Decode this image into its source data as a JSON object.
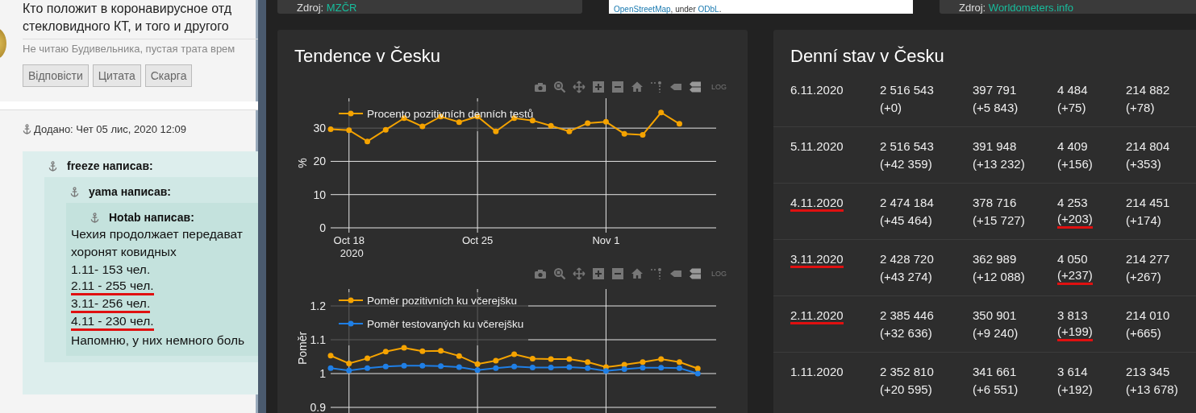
{
  "forum": {
    "post_text": [
      "Кто положит в коронавирусное отд",
      "стекловидного КТ, и того и другого"
    ],
    "signature": "Не читаю Будивельника, пустая трата врем",
    "buttons": [
      "Відповісти",
      "Цитата",
      "Скарга"
    ],
    "posted": "Додано: Чет 05 лис, 2020 12:09",
    "quote": {
      "author": "freeze написав:",
      "quote": {
        "author": "yama написав:",
        "quote": {
          "author": "Hotab написав:",
          "lines": [
            {
              "text": "Чехия продолжает передават",
              "marked": false
            },
            {
              "text": "хоронят ковидных",
              "marked": false
            },
            {
              "text": "1.11- 153 чел.",
              "marked": false
            },
            {
              "text": "2.11 - 255 чел.",
              "marked": true
            },
            {
              "text": "3.11- 256 чел.",
              "marked": true
            },
            {
              "text": "4.11 - 230 чел.",
              "marked": true
            },
            {
              "text": "Напомню, у них немного боль",
              "marked": false
            }
          ]
        }
      }
    }
  },
  "top_cards": [
    {
      "kind": "source",
      "label": "Zdroj:",
      "link": "MZČR"
    },
    {
      "kind": "attribution",
      "parts": [
        {
          "text": "OpenStreetMap",
          "link": true
        },
        {
          "text": ", under ",
          "link": false
        },
        {
          "text": "ODbL",
          "link": true
        },
        {
          "text": ".",
          "link": false
        }
      ]
    },
    {
      "kind": "source",
      "label": "Zdroj:",
      "link": "Worldometers.info"
    }
  ],
  "trend_panel": {
    "title": "Tendence v Česku",
    "charts": [
      {
        "toolbar_label": "LOG",
        "chart_data": {
          "type": "line",
          "ylabel": "%",
          "grid": true,
          "legend": true,
          "x": [
            "2020-10-17",
            "2020-10-18",
            "2020-10-19",
            "2020-10-20",
            "2020-10-21",
            "2020-10-22",
            "2020-10-23",
            "2020-10-24",
            "2020-10-25",
            "2020-10-26",
            "2020-10-27",
            "2020-10-28",
            "2020-10-29",
            "2020-10-30",
            "2020-10-31",
            "2020-11-01",
            "2020-11-02",
            "2020-11-03",
            "2020-11-04",
            "2020-11-05"
          ],
          "series": [
            {
              "name": "Procento pozitivních denních testů",
              "color": "#f5a300",
              "marker": true,
              "values": [
                29.7,
                29.4,
                26,
                29.5,
                33,
                30.5,
                33.5,
                31.8,
                33.5,
                29,
                33,
                32.3,
                30.7,
                29,
                31.5,
                31.9,
                28.3,
                28,
                34.7,
                31.3
              ]
            }
          ],
          "xlim": [
            "2020-10-17",
            "2020-11-07"
          ],
          "ylim": [
            0,
            39
          ],
          "yticks": [
            0,
            10,
            20,
            30
          ],
          "xticks": [
            {
              "value": "2020-10-18",
              "label": "Oct 18\n2020"
            },
            {
              "value": "2020-10-25",
              "label": "Oct 25"
            },
            {
              "value": "2020-11-01",
              "label": "Nov 1"
            }
          ]
        }
      },
      {
        "toolbar_label": "LOG",
        "chart_data": {
          "type": "line",
          "ylabel": "Poměr",
          "grid": true,
          "legend": true,
          "xlim": [
            "2020-10-17",
            "2020-11-07"
          ],
          "ylim": [
            0.9,
            1.25
          ],
          "x": [
            "2020-10-17",
            "2020-10-18",
            "2020-10-19",
            "2020-10-20",
            "2020-10-21",
            "2020-10-22",
            "2020-10-23",
            "2020-10-24",
            "2020-10-25",
            "2020-10-26",
            "2020-10-27",
            "2020-10-28",
            "2020-10-29",
            "2020-10-30",
            "2020-10-31",
            "2020-11-01",
            "2020-11-02",
            "2020-11-03",
            "2020-11-04",
            "2020-11-05",
            "2020-11-06"
          ],
          "series": [
            {
              "name": "Poměr pozitivních ku včerejšku",
              "color": "#f5a300",
              "marker": true,
              "values": [
                1.053,
                1.03,
                1.045,
                1.065,
                1.076,
                1.066,
                1.067,
                1.052,
                1.028,
                1.038,
                1.057,
                1.044,
                1.043,
                1.043,
                1.034,
                1.019,
                1.026,
                1.034,
                1.043,
                1.034,
                1.015
              ]
            },
            {
              "name": "Poměr testovaných ku včerejšku",
              "color": "#1f7fe6",
              "marker": true,
              "values": [
                1.016,
                1.009,
                1.016,
                1.021,
                1.023,
                1.023,
                1.022,
                1.019,
                1.01,
                1.016,
                1.021,
                1.018,
                1.018,
                1.019,
                1.016,
                1.008,
                1.013,
                1.017,
                1.017,
                1.016,
                1.0
              ]
            }
          ],
          "yticks": [
            {
              "value": 0.9,
              "label": "0.9"
            },
            {
              "value": 1,
              "label": "1"
            },
            {
              "value": 1.1,
              "label": "1.1"
            },
            {
              "value": 1.2,
              "label": "1.2"
            }
          ]
        }
      }
    ]
  },
  "daily_panel": {
    "title": "Denní stav v Česku",
    "rows": [
      {
        "date": "6.11.2020",
        "date_marked": false,
        "cells": [
          {
            "value": "2 516 543",
            "delta": "(+0)",
            "marked": false
          },
          {
            "value": "397 791",
            "delta": "(+5 843)",
            "marked": false
          },
          {
            "value": "4 484",
            "delta": "(+75)",
            "marked": false
          },
          {
            "value": "214 882",
            "delta": "(+78)",
            "marked": false
          }
        ]
      },
      {
        "date": "5.11.2020",
        "date_marked": false,
        "cells": [
          {
            "value": "2 516 543",
            "delta": "(+42 359)",
            "marked": false
          },
          {
            "value": "391 948",
            "delta": "(+13 232)",
            "marked": false
          },
          {
            "value": "4 409",
            "delta": "(+156)",
            "marked": false
          },
          {
            "value": "214 804",
            "delta": "(+353)",
            "marked": false
          }
        ]
      },
      {
        "date": "4.11.2020",
        "date_marked": true,
        "cells": [
          {
            "value": "2 474 184",
            "delta": "(+45 464)",
            "marked": false
          },
          {
            "value": "378 716",
            "delta": "(+15 727)",
            "marked": false
          },
          {
            "value": "4 253",
            "delta": "(+203)",
            "marked": true
          },
          {
            "value": "214 451",
            "delta": "(+174)",
            "marked": false
          }
        ]
      },
      {
        "date": "3.11.2020",
        "date_marked": true,
        "cells": [
          {
            "value": "2 428 720",
            "delta": "(+43 274)",
            "marked": false
          },
          {
            "value": "362 989",
            "delta": "(+12 088)",
            "marked": false
          },
          {
            "value": "4 050",
            "delta": "(+237)",
            "marked": true
          },
          {
            "value": "214 277",
            "delta": "(+267)",
            "marked": false
          }
        ]
      },
      {
        "date": "2.11.2020",
        "date_marked": true,
        "cells": [
          {
            "value": "2 385 446",
            "delta": "(+32 636)",
            "marked": false
          },
          {
            "value": "350 901",
            "delta": "(+9 240)",
            "marked": false
          },
          {
            "value": "3 813",
            "delta": "(+199)",
            "marked": true
          },
          {
            "value": "214 010",
            "delta": "(+665)",
            "marked": false
          }
        ]
      },
      {
        "date": "1.11.2020",
        "date_marked": false,
        "cells": [
          {
            "value": "2 352 810",
            "delta": "(+20 595)",
            "marked": false
          },
          {
            "value": "341 661",
            "delta": "(+6 551)",
            "marked": false
          },
          {
            "value": "3 614",
            "delta": "(+192)",
            "marked": false
          },
          {
            "value": "213 345",
            "delta": "(+13 678)",
            "marked": false
          }
        ]
      }
    ]
  }
}
